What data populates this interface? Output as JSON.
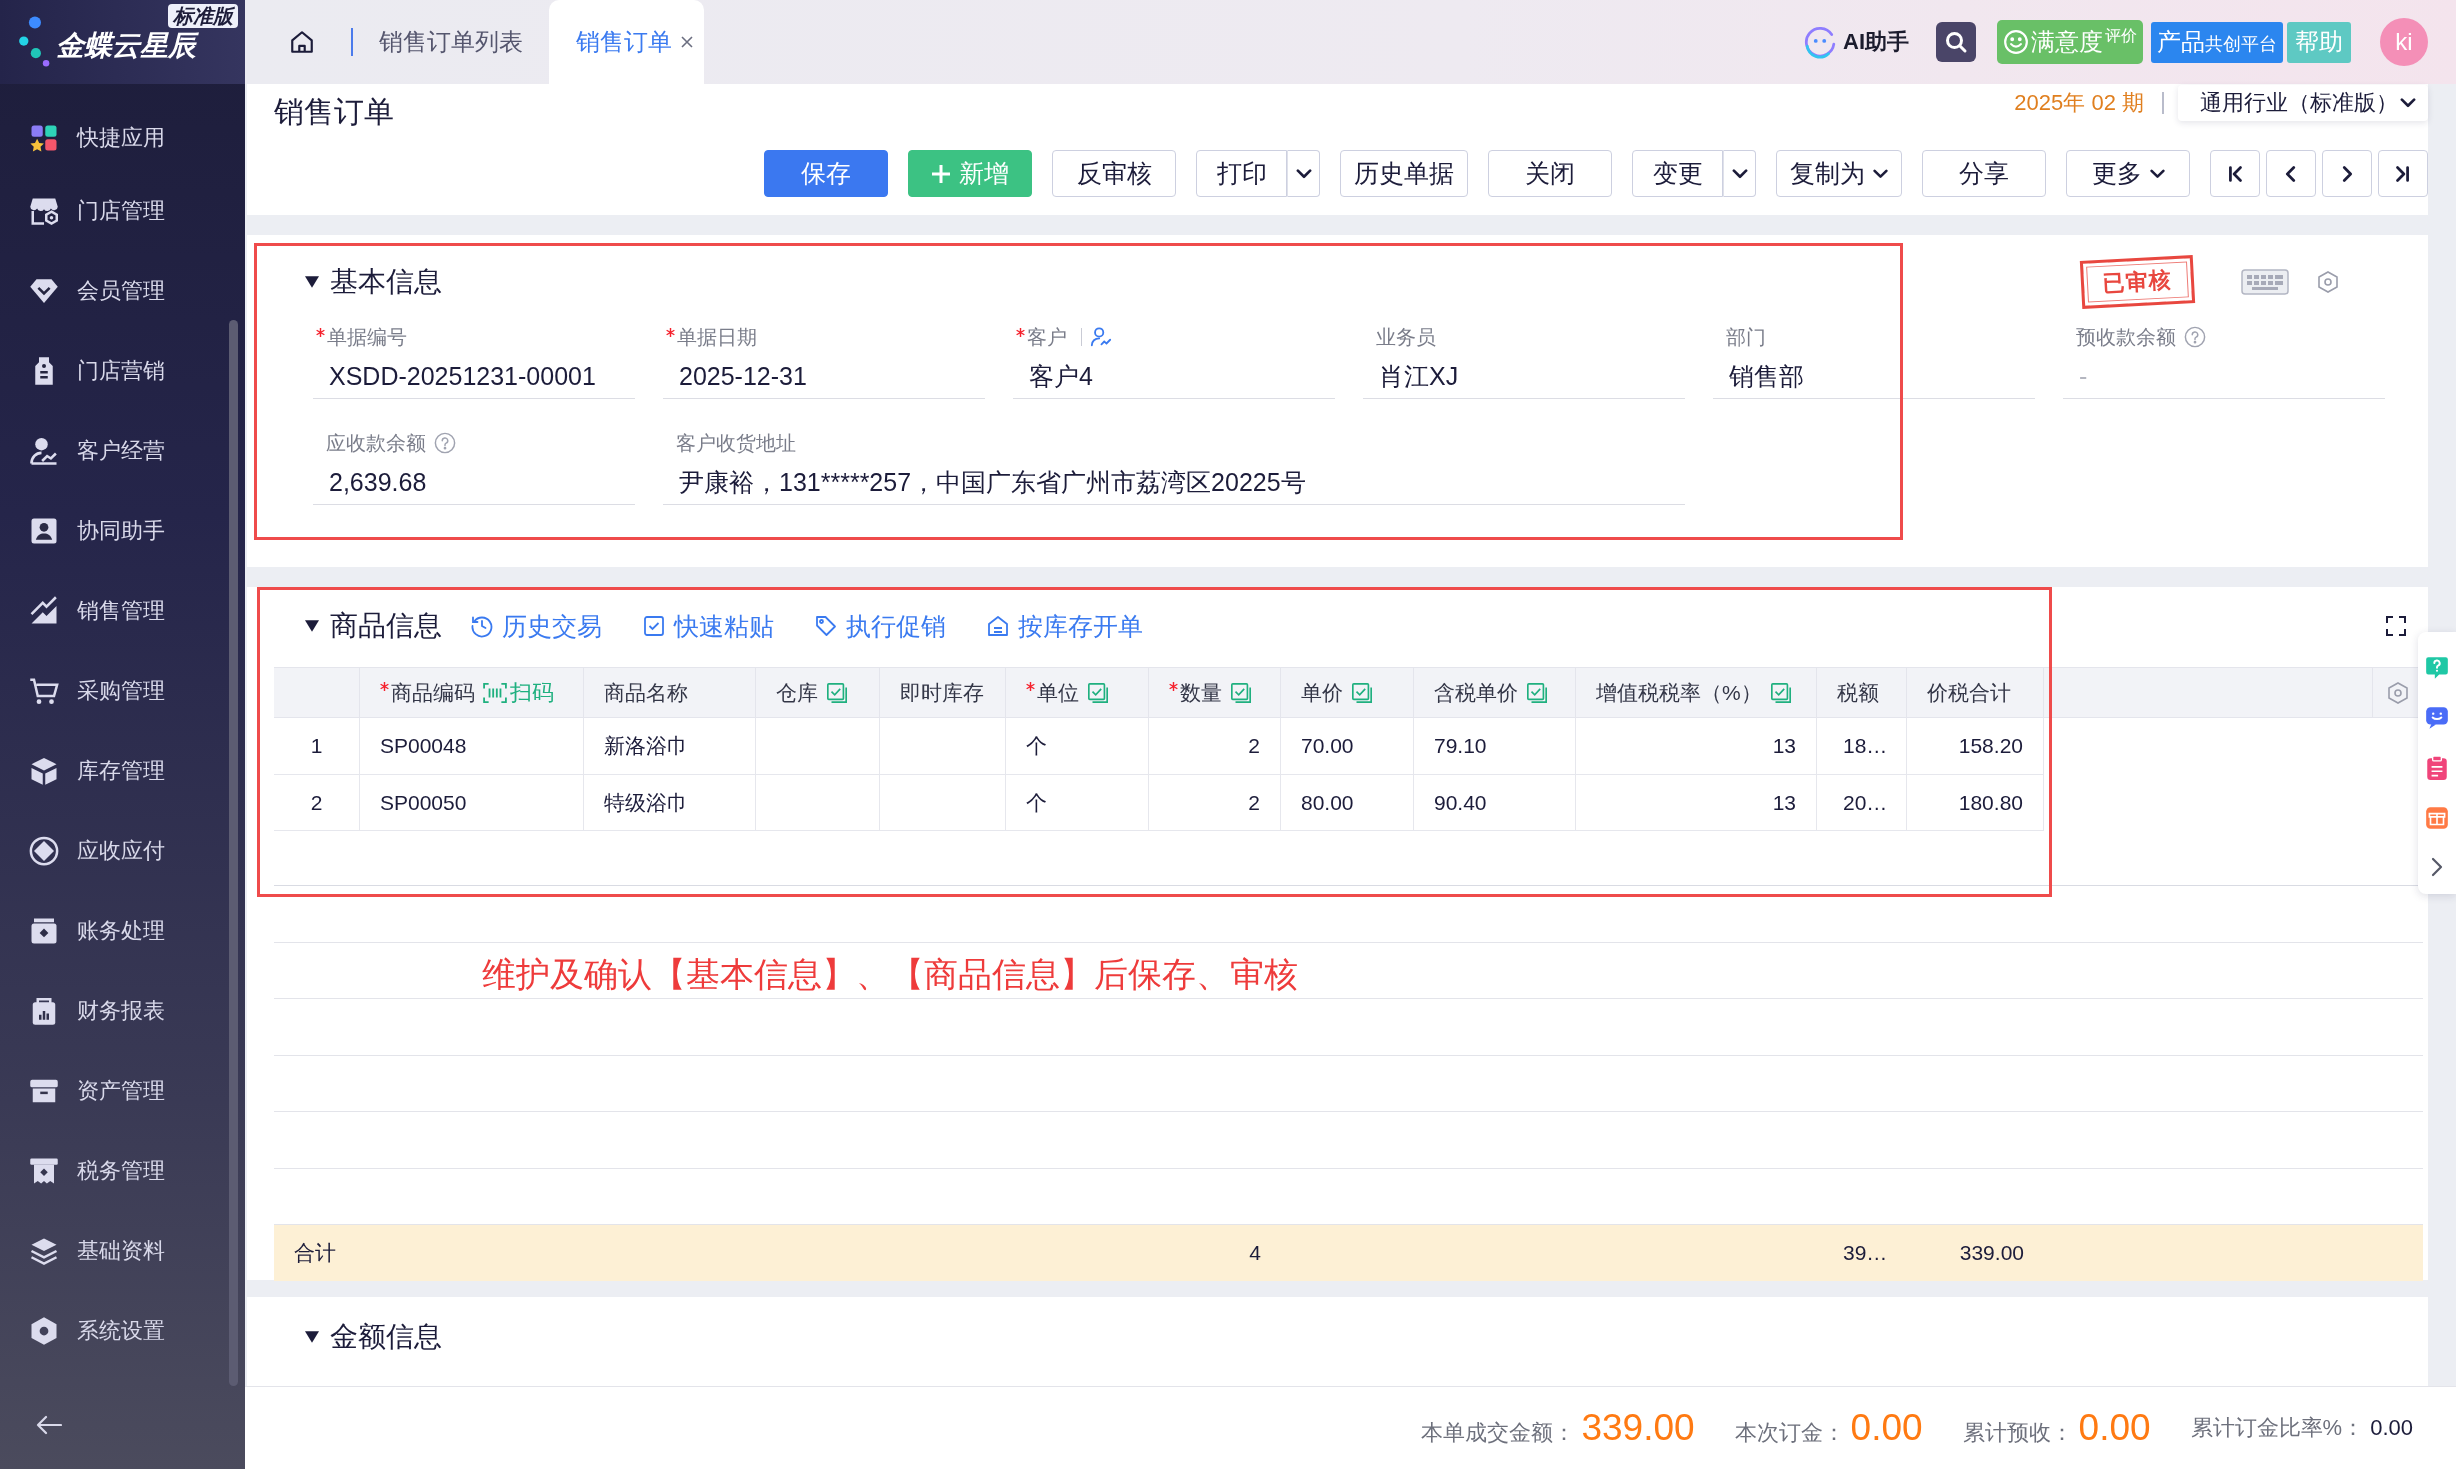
{
  "sidebar": {
    "logo": {
      "name": "金蝶云星辰",
      "edition": "标准版"
    },
    "items": [
      {
        "label": "快捷应用",
        "selected": false
      },
      {
        "label": "门店管理",
        "selected": false
      },
      {
        "label": "会员管理",
        "selected": false
      },
      {
        "label": "门店营销",
        "selected": false
      },
      {
        "label": "客户经营",
        "selected": false
      },
      {
        "label": "协同助手",
        "selected": false
      },
      {
        "label": "销售管理",
        "selected": false
      },
      {
        "label": "采购管理",
        "selected": false
      },
      {
        "label": "库存管理",
        "selected": false
      },
      {
        "label": "应收应付",
        "selected": false
      },
      {
        "label": "账务处理",
        "selected": false
      },
      {
        "label": "财务报表",
        "selected": false
      },
      {
        "label": "资产管理",
        "selected": false
      },
      {
        "label": "税务管理",
        "selected": false
      },
      {
        "label": "基础资料",
        "selected": false
      },
      {
        "label": "系统设置",
        "selected": false
      }
    ]
  },
  "top_bar": {
    "tabs": [
      {
        "label": "销售订单列表",
        "selected": false,
        "closable": false
      },
      {
        "label": "销售订单",
        "selected": true,
        "closable": true
      }
    ],
    "assistant": "AI助手",
    "rating_button": {
      "label": "满意度",
      "note": "评价"
    },
    "platform_button": {
      "label": "产品",
      "note": "共创平台"
    },
    "help_button": "帮助",
    "avatar": "ki"
  },
  "page": {
    "title": "销售订单",
    "period": "2025年 02 期",
    "industry": "通用行业（标准版）"
  },
  "toolbar": [
    {
      "label": "保存",
      "kind": "primary"
    },
    {
      "label": "新增",
      "kind": "add"
    },
    {
      "label": "反审核",
      "kind": "plain"
    },
    {
      "label": "打印",
      "kind": "split"
    },
    {
      "label": "历史单据",
      "kind": "plain"
    },
    {
      "label": "关闭",
      "kind": "plain"
    },
    {
      "label": "变更",
      "kind": "split"
    },
    {
      "label": "复制为",
      "kind": "menu"
    },
    {
      "label": "分享",
      "kind": "plain"
    },
    {
      "label": "更多",
      "kind": "menu"
    }
  ],
  "basic_info": {
    "title": "基本信息",
    "expanded": true,
    "highlighted": true,
    "stamp": "已审核",
    "fields": [
      {
        "label": "单据编号",
        "required": true,
        "kind": "text",
        "value": "XSDD-20251231-00001",
        "disabled": false
      },
      {
        "label": "单据日期",
        "required": true,
        "kind": "text",
        "value": "2025-12-31",
        "disabled": false
      },
      {
        "label": "客户",
        "required": true,
        "kind": "picker",
        "value": "客户4",
        "disabled": false
      },
      {
        "label": "业务员",
        "required": false,
        "kind": "text",
        "value": "肖江XJ",
        "disabled": false
      },
      {
        "label": "部门",
        "required": false,
        "kind": "text",
        "value": "销售部",
        "disabled": false
      },
      {
        "label": "预收款余额",
        "required": false,
        "kind": "info",
        "value": "-",
        "disabled": true
      },
      {
        "label": "应收款余额",
        "required": false,
        "kind": "info",
        "value": "2,639.68",
        "disabled": false
      },
      {
        "label": "客户收货地址",
        "required": false,
        "kind": "wide",
        "value": "尹康裕，131*****257，中国广东省广州市荔湾区20225号",
        "disabled": false
      }
    ]
  },
  "products": {
    "title": "商品信息",
    "expanded": true,
    "highlighted": true,
    "actions": [
      {
        "label": "历史交易"
      },
      {
        "label": "快速粘贴"
      },
      {
        "label": "执行促销"
      },
      {
        "label": "按库存开单"
      }
    ],
    "columns": [
      {
        "label": "商品编码",
        "required": true,
        "batch_fill": false,
        "scan": "扫码"
      },
      {
        "label": "商品名称",
        "required": false,
        "batch_fill": false
      },
      {
        "label": "仓库",
        "required": false,
        "batch_fill": true
      },
      {
        "label": "即时库存",
        "required": false,
        "batch_fill": false
      },
      {
        "label": "单位",
        "required": true,
        "batch_fill": true
      },
      {
        "label": "数量",
        "required": true,
        "batch_fill": true
      },
      {
        "label": "单价",
        "required": false,
        "batch_fill": true
      },
      {
        "label": "含税单价",
        "required": false,
        "batch_fill": true
      },
      {
        "label": "增值税税率（%）",
        "required": false,
        "batch_fill": true
      },
      {
        "label": "税额",
        "required": false,
        "batch_fill": false
      },
      {
        "label": "价税合计",
        "required": false,
        "batch_fill": false
      }
    ],
    "rows": [
      {
        "number": "1",
        "selected": false,
        "code": "SP00048",
        "name": "新洛浴巾",
        "unit": "个",
        "quantity": "2",
        "price": "70.00",
        "tax_price": "79.10",
        "tax_rate": "13",
        "tax": "18…",
        "amount": "158.20"
      },
      {
        "number": "2",
        "selected": false,
        "code": "SP00050",
        "name": "特级浴巾",
        "unit": "个",
        "quantity": "2",
        "price": "80.00",
        "tax_price": "90.40",
        "tax_rate": "13",
        "tax": "20…",
        "amount": "180.80"
      }
    ],
    "totals": {
      "label": "合计",
      "quantity": "4",
      "tax": "39…",
      "amount": "339.00"
    }
  },
  "annotation": {
    "text": "维护及确认【基本信息】、【商品信息】后保存、审核"
  },
  "amount_info": {
    "title": "金额信息",
    "expanded": true
  },
  "summary": [
    {
      "label": "本单成交金额：",
      "value": "339.00",
      "kind": "amount"
    },
    {
      "label": "本次订金：",
      "value": "0.00",
      "kind": "amount"
    },
    {
      "label": "累计预收：",
      "value": "0.00",
      "kind": "amount"
    },
    {
      "label": "累计订金比率%：",
      "value": "0.00",
      "kind": "ratio"
    }
  ]
}
